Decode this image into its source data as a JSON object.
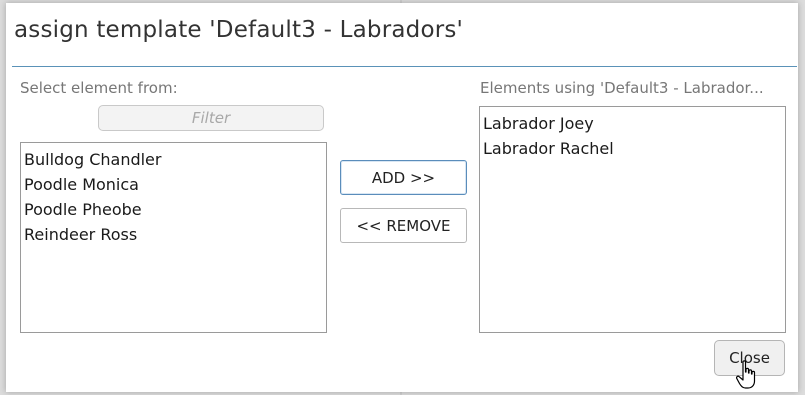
{
  "dialog": {
    "title": "assign template 'Default3 - Labradors'"
  },
  "left_pane": {
    "label": "Select element from:",
    "filter_placeholder": "Filter",
    "items": [
      "Bulldog Chandler",
      "Poodle Monica",
      "Poodle Pheobe",
      "Reindeer Ross"
    ]
  },
  "right_pane": {
    "label": "Elements using 'Default3 - Labrador...",
    "items": [
      "Labrador Joey",
      "Labrador Rachel"
    ]
  },
  "buttons": {
    "add_label": "ADD >>",
    "remove_label": "<< REMOVE",
    "close_label": "Close"
  },
  "colors": {
    "title_rule": "#5a92b8",
    "add_border": "#5a8dbb"
  },
  "icons": {
    "cursor": "hand-pointer-icon"
  }
}
